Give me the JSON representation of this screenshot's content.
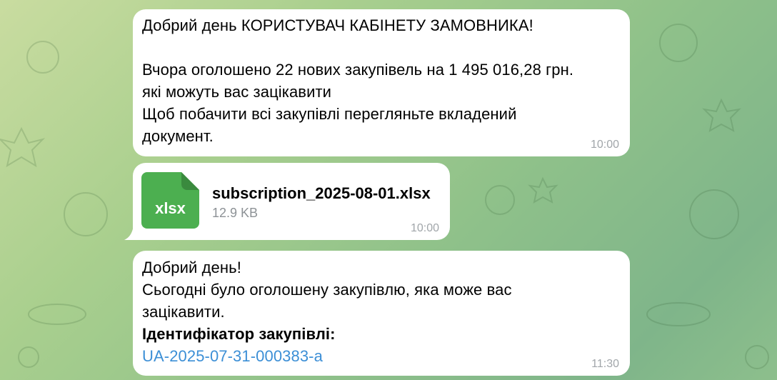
{
  "messages": [
    {
      "text": "Добрий день  КОРИСТУВАЧ КАБІНЕТУ ЗАМОВНИКА!\n\nВчора оголошено 22 нових закупівель  на 1 495 016,28 грн.\nякі можуть вас зацікавити\nЩоб побачити всі закупівлі перегляньте вкладений\nдокумент.",
      "time": "10:00"
    },
    {
      "file": {
        "icon": "spreadsheet-file-icon",
        "ext": "xlsx",
        "name": "subscription_2025-08-01.xlsx",
        "size": "12.9 KB"
      },
      "time": "10:00"
    },
    {
      "text": "Добрий день!\nСьогодні було оголошену закупівлю, яка може вас\nзацікавити.",
      "label": "Ідентифікатор закупівлі:",
      "link": "UA-2025-07-31-000383-a",
      "time": "11:30"
    }
  ],
  "colors": {
    "bubble": "#ffffff",
    "file_icon": "#4caf50",
    "link": "#3c8fd6",
    "time": "#a1a6aa"
  }
}
